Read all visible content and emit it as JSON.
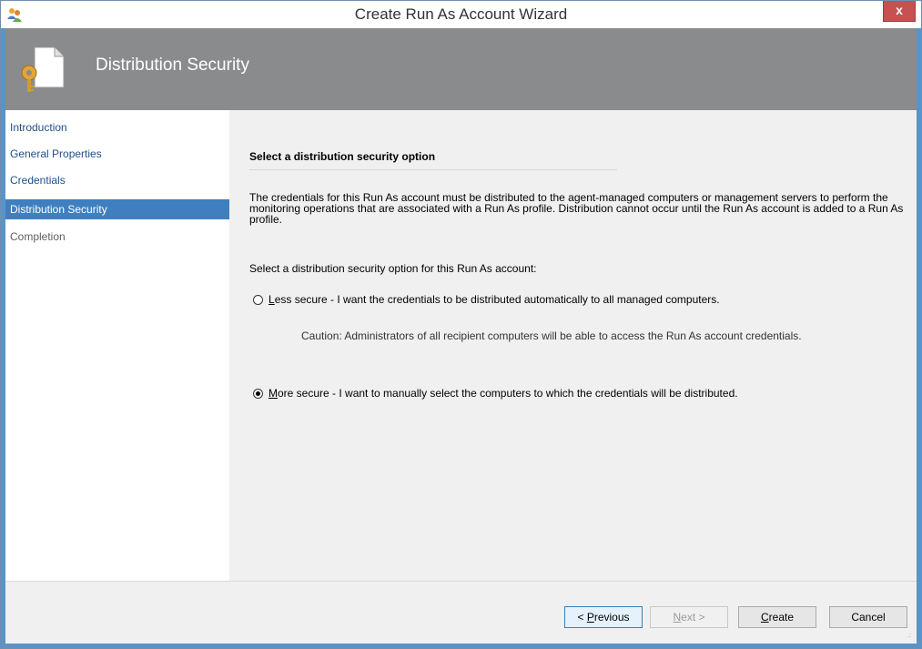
{
  "window": {
    "title": "Create Run As Account Wizard",
    "close_label": "x"
  },
  "header": {
    "title": "Distribution Security"
  },
  "nav": {
    "items": [
      {
        "label": "Introduction",
        "state": "normal"
      },
      {
        "label": "General Properties",
        "state": "normal"
      },
      {
        "label": "Credentials",
        "state": "normal"
      },
      {
        "label": "Distribution Security",
        "state": "active"
      },
      {
        "label": "Completion",
        "state": "disabled"
      }
    ]
  },
  "content": {
    "heading": "Select a distribution security option",
    "description": "The credentials for this Run As account must be distributed to the agent-managed computers or management servers to perform the monitoring operations that are associated with a Run As profile. Distribution cannot occur until the Run As account is added to a Run As profile.",
    "prompt": "Select a distribution security option for this Run As account:",
    "options": [
      {
        "accelerator": "L",
        "label_rest": "ess secure - I want the credentials to be distributed automatically to all managed computers.",
        "checked": false
      },
      {
        "accelerator": "M",
        "label_rest": "ore secure - I want to manually select the computers to which the credentials will be distributed.",
        "checked": true
      }
    ],
    "caution": "Caution: Administrators of all recipient computers will be able to access the Run As account credentials."
  },
  "footer": {
    "previous": {
      "pre": "< ",
      "accel": "P",
      "post": "revious"
    },
    "next": {
      "accel": "N",
      "post": "ext >"
    },
    "create": {
      "accel": "C",
      "post": "reate"
    },
    "cancel": "Cancel"
  },
  "colors": {
    "header_bg": "#8a8b8c",
    "nav_active": "#3f7fc0",
    "close_bg": "#c75050"
  }
}
